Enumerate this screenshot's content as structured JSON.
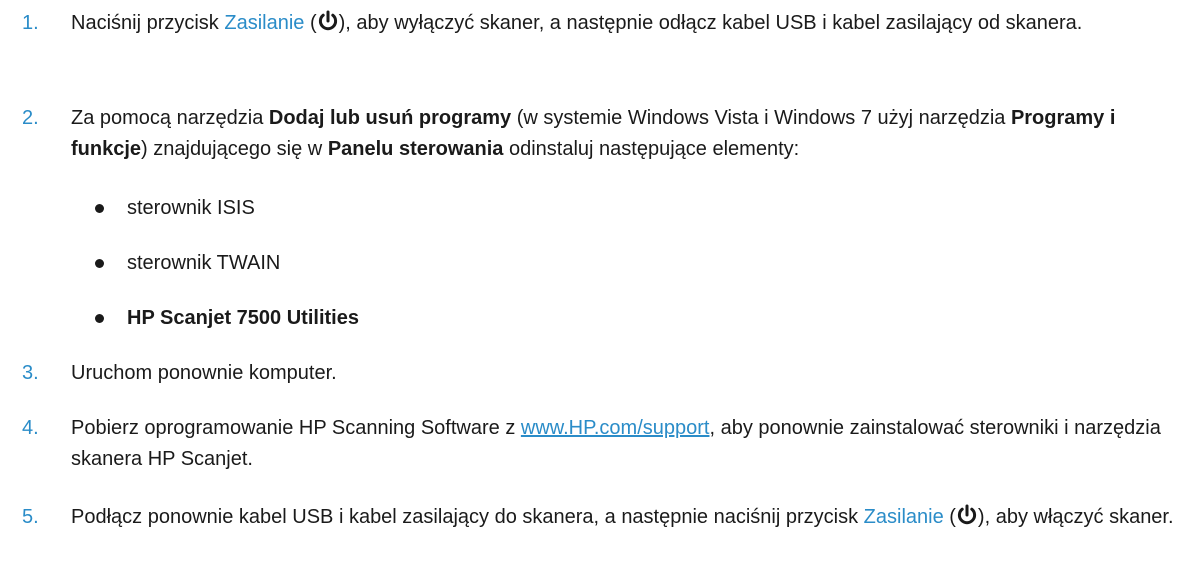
{
  "steps": [
    {
      "num": "1.",
      "t1": "Naciśnij przycisk ",
      "btn": "Zasilanie",
      "t2": " (",
      "t3": "), aby wyłączyć skaner, a następnie odłącz kabel USB i kabel zasilający od skanera."
    },
    {
      "num": "2.",
      "t1": "Za pomocą narzędzia ",
      "b1": "Dodaj lub usuń programy",
      "t2": " (w systemie Windows Vista i Windows 7 użyj narzędzia ",
      "b2": "Programy i funkcje",
      "t3": ") znajdującego się w ",
      "b3": "Panelu sterowania",
      "t4": " odinstaluj następujące elementy:",
      "bullets": [
        "sterownik ISIS",
        "sterownik TWAIN",
        "HP Scanjet 7500 Utilities"
      ]
    },
    {
      "num": "3.",
      "text": "Uruchom ponownie komputer."
    },
    {
      "num": "4.",
      "t1": "Pobierz oprogramowanie HP Scanning Software z ",
      "link": "www.HP.com/support",
      "t2": ", aby ponownie zainstalować sterowniki i narzędzia skanera HP Scanjet."
    },
    {
      "num": "5.",
      "t1": "Podłącz ponownie kabel USB i kabel zasilający do skanera, a następnie naciśnij przycisk ",
      "btn": "Zasilanie",
      "t2": " (",
      "t3": "), aby włączyć skaner."
    }
  ],
  "icons": {
    "power": "power-icon"
  },
  "colors": {
    "accent": "#2a8cc8",
    "text": "#1a1a1a"
  }
}
